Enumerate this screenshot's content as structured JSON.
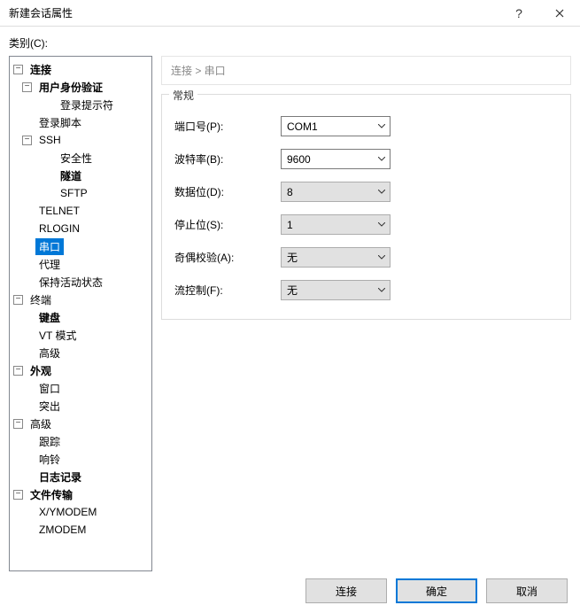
{
  "window": {
    "title": "新建会话属性",
    "help_label": "?",
    "close_label": "✕"
  },
  "category_label": "类别(C):",
  "breadcrumb": "连接 > 串口",
  "group": {
    "legend": "常规",
    "fields": {
      "port": {
        "label": "端口号(P):",
        "value": "COM1"
      },
      "baud": {
        "label": "波特率(B):",
        "value": "9600"
      },
      "data": {
        "label": "数据位(D):",
        "value": "8"
      },
      "stop": {
        "label": "停止位(S):",
        "value": "1"
      },
      "parity": {
        "label": "奇偶校验(A):",
        "value": "无"
      },
      "flow": {
        "label": "流控制(F):",
        "value": "无"
      }
    }
  },
  "buttons": {
    "connect": "连接",
    "ok": "确定",
    "cancel": "取消"
  },
  "tree": {
    "n_connection": "连接",
    "n_userauth": "用户身份验证",
    "n_loginprompt": "登录提示符",
    "n_loginscript": "登录脚本",
    "n_ssh": "SSH",
    "n_security": "安全性",
    "n_tunnel": "隧道",
    "n_sftp": "SFTP",
    "n_telnet": "TELNET",
    "n_rlogin": "RLOGIN",
    "n_serial": "串口",
    "n_proxy": "代理",
    "n_keepalive": "保持活动状态",
    "n_terminal": "终端",
    "n_keyboard": "键盘",
    "n_vtmode": "VT 模式",
    "n_term_adv": "高级",
    "n_appearance": "外观",
    "n_window": "窗口",
    "n_highlight": "突出",
    "n_advanced": "高级",
    "n_trace": "跟踪",
    "n_bell": "响铃",
    "n_logging": "日志记录",
    "n_filetrans": "文件传输",
    "n_xymodem": "X/YMODEM",
    "n_zmodem": "ZMODEM"
  }
}
